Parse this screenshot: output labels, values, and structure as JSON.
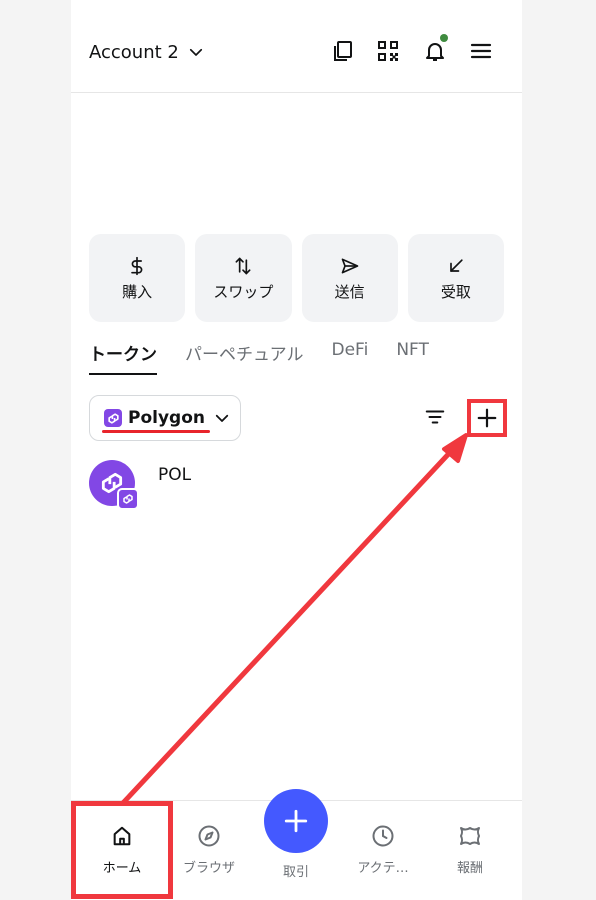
{
  "header": {
    "account_label": "Account 2",
    "icons": [
      "copy-icon",
      "qr-code-icon",
      "bell-icon",
      "menu-icon"
    ]
  },
  "actions": [
    {
      "label": "購入",
      "icon": "dollar-icon"
    },
    {
      "label": "スワップ",
      "icon": "swap-icon"
    },
    {
      "label": "送信",
      "icon": "send-icon"
    },
    {
      "label": "受取",
      "icon": "receive-icon"
    }
  ],
  "tabs": [
    "トークン",
    "パーペチュアル",
    "DeFi",
    "NFT"
  ],
  "active_tab": "トークン",
  "network": {
    "name": "Polygon"
  },
  "tokens": [
    {
      "symbol": "POL"
    }
  ],
  "bottom_nav": {
    "items": [
      {
        "label": "ホーム",
        "icon": "home-icon"
      },
      {
        "label": "ブラウザ",
        "icon": "compass-icon"
      },
      {
        "label": "取引",
        "icon": "plus-icon"
      },
      {
        "label": "アクテ…",
        "icon": "clock-icon"
      },
      {
        "label": "報酬",
        "icon": "rewards-icon"
      }
    ]
  },
  "colors": {
    "accent": "#4459ff",
    "polygon": "#8247e5",
    "annotation_red": "#f0383e",
    "notification_dot": "#3f8b3f"
  }
}
